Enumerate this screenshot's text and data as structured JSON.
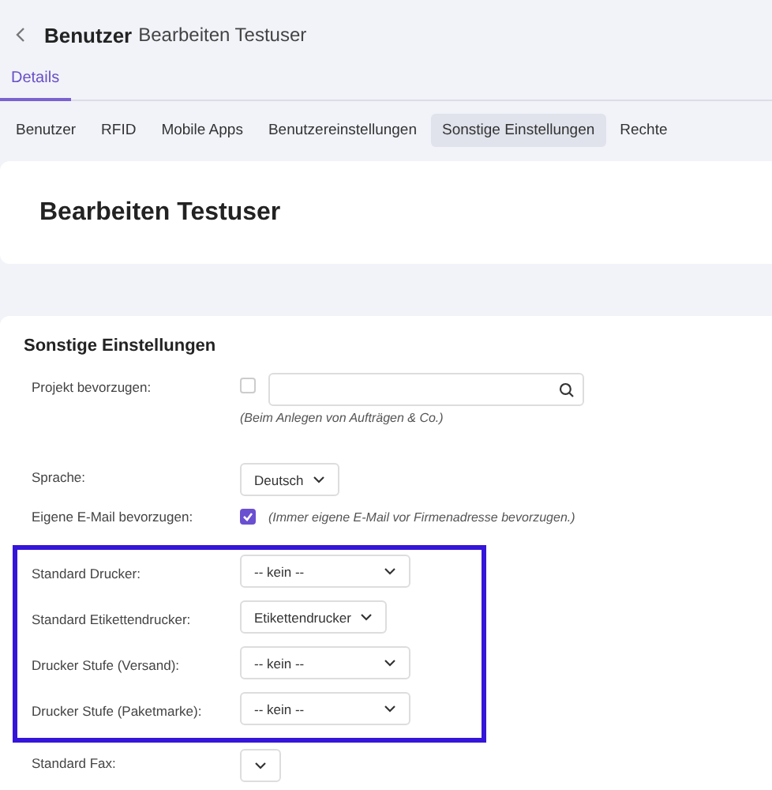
{
  "header": {
    "title": "Benutzer",
    "subtitle": "Bearbeiten Testuser"
  },
  "tabs": [
    {
      "label": "Details",
      "selected": true
    }
  ],
  "subtabs": [
    {
      "label": "Benutzer",
      "selected": false
    },
    {
      "label": "RFID",
      "selected": false
    },
    {
      "label": "Mobile Apps",
      "selected": false
    },
    {
      "label": "Benutzereinstellungen",
      "selected": false
    },
    {
      "label": "Sonstige Einstellungen",
      "selected": true
    },
    {
      "label": "Rechte",
      "selected": false
    }
  ],
  "card_title": "Bearbeiten Testuser",
  "section": {
    "title": "Sonstige Einstellungen",
    "field_groups": [
      {
        "highlighted": false,
        "fields": [
          {
            "kind": "search",
            "label": "Projekt bevorzugen:",
            "checked": false,
            "hint": "(Beim Anlegen von Aufträgen & Co.)"
          },
          {
            "kind": "select",
            "label": "Sprache:",
            "value": "Deutsch"
          },
          {
            "kind": "checkbox",
            "label": "Eigene E-Mail bevorzugen:",
            "checked": true,
            "hint": "(Immer eigene E-Mail vor Firmenadresse bevorzugen.)"
          }
        ]
      },
      {
        "highlighted": true,
        "fields": [
          {
            "kind": "select",
            "label": "Standard Drucker:",
            "value": "-- kein --"
          },
          {
            "kind": "select",
            "label": "Standard Etikettendrucker:",
            "value": "Etikettendrucker"
          },
          {
            "kind": "select",
            "label": "Drucker Stufe (Versand):",
            "value": "-- kein --"
          },
          {
            "kind": "select",
            "label": "Drucker Stufe (Paketmarke):",
            "value": "-- kein --"
          }
        ]
      },
      {
        "highlighted": false,
        "fields": [
          {
            "kind": "select",
            "label": "Standard Fax:"
          }
        ]
      }
    ]
  }
}
